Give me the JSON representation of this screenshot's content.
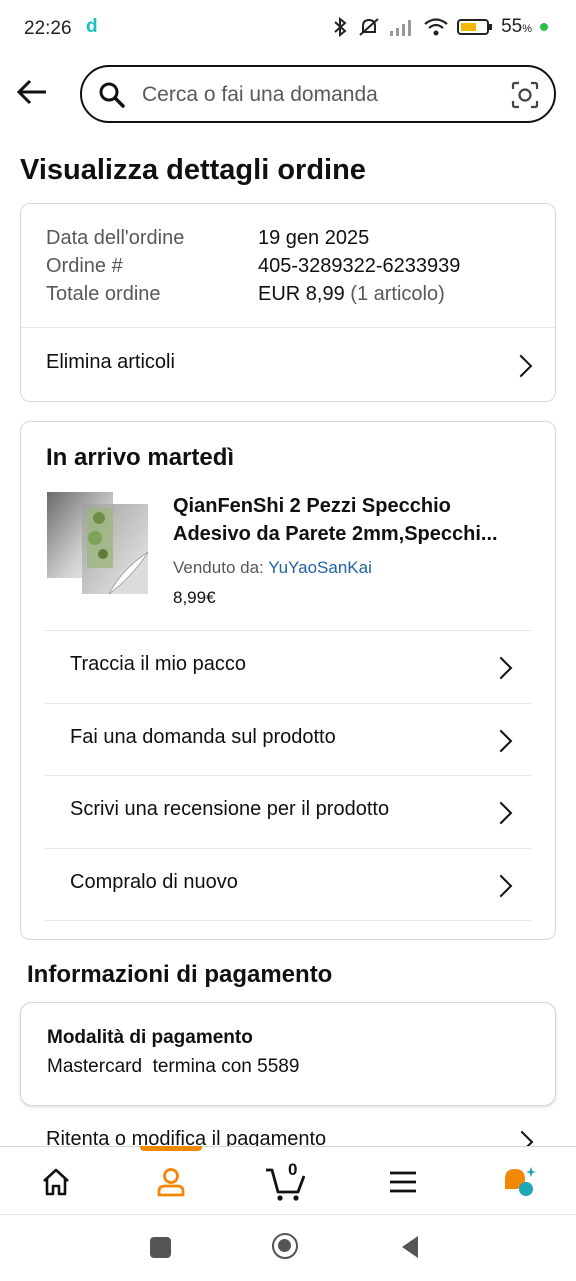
{
  "status": {
    "time": "22:26",
    "app_letter": "d",
    "battery": "55",
    "battery_unit": "%"
  },
  "search": {
    "placeholder": "Cerca o fai una domanda"
  },
  "page_title": "Visualizza dettagli ordine",
  "order": {
    "rows": [
      {
        "label": "Data dell'ordine",
        "value": "19 gen 2025",
        "extra": ""
      },
      {
        "label": "Ordine #",
        "value": "405-3289322-6233939",
        "extra": ""
      },
      {
        "label": "Totale ordine",
        "value": "EUR 8,99",
        "extra": "(1 articolo)"
      }
    ],
    "delete_items": "Elimina articoli"
  },
  "shipment": {
    "title": "In arrivo martedì",
    "product": {
      "title_line1": "QianFenShi 2 Pezzi Specchio",
      "title_line2": "Adesivo da Parete 2mm,Specchi...",
      "seller_label": "Venduto da:",
      "seller_name": "YuYaoSanKai",
      "price": "8,99€"
    },
    "actions": [
      "Traccia il mio pacco",
      "Fai una domanda sul prodotto",
      "Scrivi una recensione per il prodotto",
      "Compralo di nuovo"
    ]
  },
  "payment": {
    "title": "Informazioni di pagamento",
    "method_label": "Modalità di pagamento",
    "method_value": "Mastercard  termina con 5589",
    "retry": "Ritenta o modifica il pagamento"
  },
  "bottom_nav": {
    "cart_count": "0",
    "active": "account"
  },
  "colors": {
    "accent": "#f08804",
    "link": "#2162a1",
    "border": "#d5d9d9",
    "assistant_teal": "#1fa6b8"
  }
}
